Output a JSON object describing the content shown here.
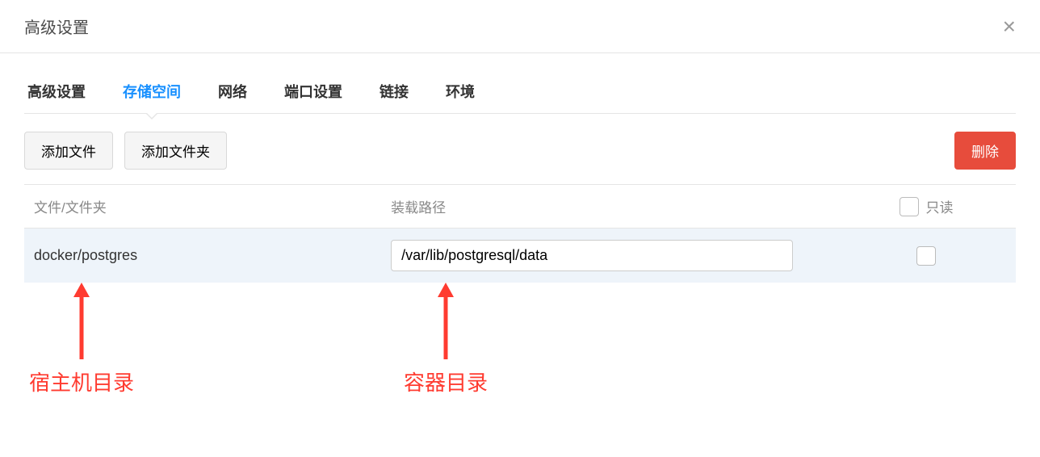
{
  "modal": {
    "title": "高级设置"
  },
  "tabs": [
    {
      "label": "高级设置",
      "active": false
    },
    {
      "label": "存储空间",
      "active": true
    },
    {
      "label": "网络",
      "active": false
    },
    {
      "label": "端口设置",
      "active": false
    },
    {
      "label": "链接",
      "active": false
    },
    {
      "label": "环境",
      "active": false
    }
  ],
  "toolbar": {
    "add_file_label": "添加文件",
    "add_folder_label": "添加文件夹",
    "delete_label": "删除"
  },
  "table": {
    "headers": {
      "file": "文件/文件夹",
      "mount": "装载路径",
      "readonly": "只读"
    },
    "rows": [
      {
        "file": "docker/postgres",
        "mount": "/var/lib/postgresql/data",
        "readonly": false
      }
    ]
  },
  "annotations": {
    "host_dir": "宿主机目录",
    "container_dir": "容器目录"
  },
  "colors": {
    "primary": "#1890ff",
    "danger": "#e74c3c",
    "annotation": "#ff3b30"
  }
}
